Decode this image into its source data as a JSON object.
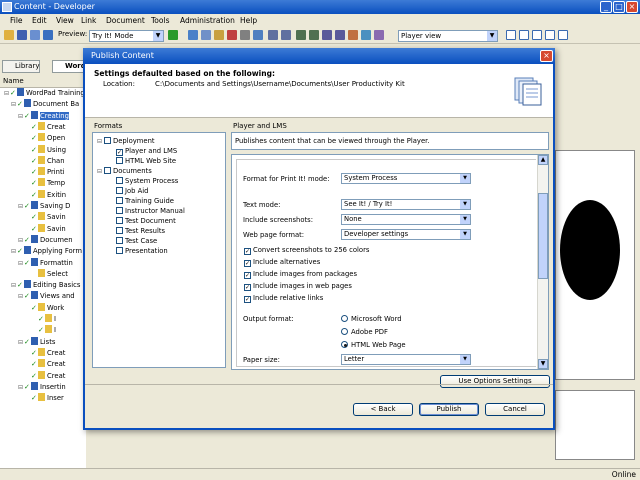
{
  "app": {
    "title": "Content - Developer",
    "caption_buttons": [
      "_",
      "□",
      "×"
    ]
  },
  "menu": [
    "File",
    "Edit",
    "View",
    "Link",
    "Document",
    "Tools",
    "Administration",
    "Help"
  ],
  "toolbar": {
    "preview_label": "Preview:",
    "preview_value": "Try It! Mode",
    "view_value": "Player view"
  },
  "left_pane": {
    "tabs": [
      "Library",
      "Word"
    ],
    "column_header": "Name",
    "tree": [
      {
        "label": "WordPad Training",
        "level": 0,
        "check": true,
        "selected": false
      },
      {
        "label": "Document Ba",
        "level": 1,
        "check": true,
        "selected": false
      },
      {
        "label": "Creating",
        "level": 2,
        "check": true,
        "selected": true
      },
      {
        "label": "Creat",
        "level": 3,
        "check": true,
        "selected": false
      },
      {
        "label": "Open",
        "level": 3,
        "check": true,
        "selected": false
      },
      {
        "label": "Using",
        "level": 3,
        "check": true,
        "selected": false
      },
      {
        "label": "Chan",
        "level": 3,
        "check": true,
        "selected": false
      },
      {
        "label": "Printi",
        "level": 3,
        "check": true,
        "selected": false
      },
      {
        "label": "Temp",
        "level": 3,
        "check": true,
        "selected": false
      },
      {
        "label": "Exitin",
        "level": 3,
        "check": true,
        "selected": false
      },
      {
        "label": "Saving D",
        "level": 2,
        "check": true,
        "selected": false
      },
      {
        "label": "Savin",
        "level": 3,
        "check": true,
        "selected": false
      },
      {
        "label": "Savin",
        "level": 3,
        "check": true,
        "selected": false
      },
      {
        "label": "Documen",
        "level": 2,
        "check": true,
        "selected": false
      },
      {
        "label": "Applying Form",
        "level": 1,
        "check": true,
        "selected": false
      },
      {
        "label": "Formattin",
        "level": 2,
        "check": true,
        "selected": false
      },
      {
        "label": "Select",
        "level": 3,
        "check": false,
        "selected": false
      },
      {
        "label": "Editing Basics",
        "level": 1,
        "check": true,
        "selected": false
      },
      {
        "label": "Views and",
        "level": 2,
        "check": true,
        "selected": false
      },
      {
        "label": "Work",
        "level": 3,
        "check": true,
        "selected": false
      },
      {
        "label": "I",
        "level": 4,
        "check": true,
        "selected": false
      },
      {
        "label": "I",
        "level": 4,
        "check": true,
        "selected": false
      },
      {
        "label": "Lists",
        "level": 2,
        "check": true,
        "selected": false
      },
      {
        "label": "Creat",
        "level": 3,
        "check": true,
        "selected": false
      },
      {
        "label": "Creat",
        "level": 3,
        "check": true,
        "selected": false
      },
      {
        "label": "Creat",
        "level": 3,
        "check": true,
        "selected": false
      },
      {
        "label": "Insertin",
        "level": 2,
        "check": true,
        "selected": false
      },
      {
        "label": "Inser",
        "level": 3,
        "check": true,
        "selected": false
      }
    ]
  },
  "status": {
    "online": "Online"
  },
  "dialog": {
    "title": "Publish Content",
    "close": "×",
    "header_title": "Settings defaulted based on the following:",
    "location_label": "Location:",
    "location_value": "C:\\Documents and Settings\\Username\\Documents\\User Productivity Kit",
    "formats_label": "Formats",
    "formats": [
      {
        "label": "Deployment",
        "level": 0,
        "checked": false
      },
      {
        "label": "Player and LMS",
        "level": 1,
        "checked": true
      },
      {
        "label": "HTML Web Site",
        "level": 1,
        "checked": false
      },
      {
        "label": "Documents",
        "level": 0,
        "checked": false
      },
      {
        "label": "System Process",
        "level": 1,
        "checked": false
      },
      {
        "label": "Job Aid",
        "level": 1,
        "checked": false
      },
      {
        "label": "Training Guide",
        "level": 1,
        "checked": false
      },
      {
        "label": "Instructor Manual",
        "level": 1,
        "checked": false
      },
      {
        "label": "Test Document",
        "level": 1,
        "checked": false
      },
      {
        "label": "Test Results",
        "level": 1,
        "checked": false
      },
      {
        "label": "Test Case",
        "level": 1,
        "checked": false
      },
      {
        "label": "Presentation",
        "level": 1,
        "checked": false
      }
    ],
    "section_title": "Player and LMS",
    "section_desc": "Publishes content that can be viewed through the Player.",
    "options": {
      "print_mode_label": "Format for Print It! mode:",
      "print_mode_value": "System Process",
      "text_mode_label": "Text mode:",
      "text_mode_value": "See It! / Try It!",
      "screenshots_label": "Include screenshots:",
      "screenshots_value": "None",
      "web_format_label": "Web page format:",
      "web_format_value": "Developer settings",
      "checkboxes": [
        {
          "label": "Convert screenshots to 256 colors",
          "checked": true
        },
        {
          "label": "Include alternatives",
          "checked": true
        },
        {
          "label": "Include images from packages",
          "checked": true
        },
        {
          "label": "Include images in web pages",
          "checked": true
        },
        {
          "label": "Include relative links",
          "checked": true
        }
      ],
      "output_format_label": "Output format:",
      "output_formats": [
        {
          "label": "Microsoft Word",
          "selected": false
        },
        {
          "label": "Adobe PDF",
          "selected": false
        },
        {
          "label": "HTML Web Page",
          "selected": true
        }
      ],
      "paper_size_label": "Paper size:",
      "paper_size_value": "Letter"
    },
    "buttons": {
      "use_options": "Use Options Settings",
      "back": "< Back",
      "publish": "Publish",
      "cancel": "Cancel"
    }
  },
  "colors": {
    "accent": "#0a4fbf",
    "selection": "#316ac5",
    "check": "#1a8a1a"
  }
}
